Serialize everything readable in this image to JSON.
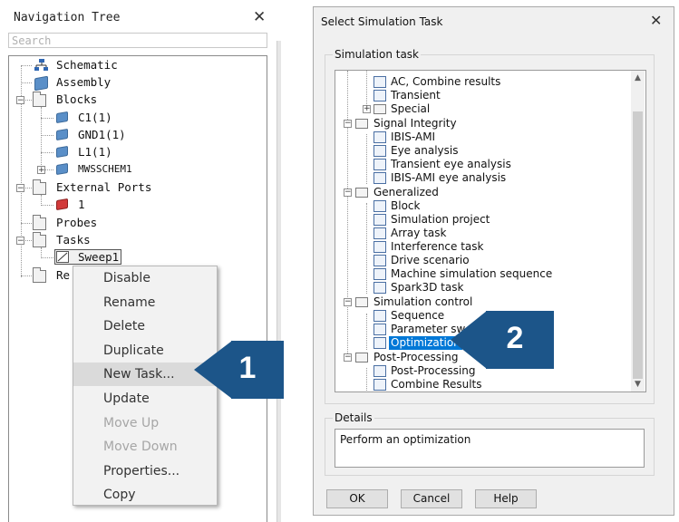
{
  "nav": {
    "title": "Navigation Tree",
    "close": "✕",
    "search_placeholder": "Search",
    "items": {
      "schematic": "Schematic",
      "assembly": "Assembly",
      "blocks": "Blocks",
      "c1": "C1(1)",
      "gnd1": "GND1(1)",
      "l1": "L1(1)",
      "mwsschem1": "MWSSCHEM1",
      "external_ports": "External Ports",
      "port1": "1",
      "probes": "Probes",
      "tasks": "Tasks",
      "sweep1": "Sweep1",
      "results_partial": "Re"
    }
  },
  "context_menu": {
    "items": [
      {
        "label": "Disable",
        "enabled": true
      },
      {
        "label": "Rename",
        "enabled": true
      },
      {
        "label": "Delete",
        "enabled": true
      },
      {
        "label": "Duplicate",
        "enabled": true
      },
      {
        "label": "New Task...",
        "enabled": true,
        "highlighted": true
      },
      {
        "label": "Update",
        "enabled": true
      },
      {
        "label": "Move Up",
        "enabled": false
      },
      {
        "label": "Move Down",
        "enabled": false
      },
      {
        "label": "Properties...",
        "enabled": true
      },
      {
        "label": "Copy",
        "enabled": true
      }
    ]
  },
  "callouts": {
    "one": "1",
    "two": "2",
    "color": "#1c5589"
  },
  "dialog": {
    "title": "Select Simulation Task",
    "close": "✕",
    "task_group_label": "Simulation task",
    "tasks": {
      "ac_combine": "AC, Combine results",
      "transient": "Transient",
      "special": "Special",
      "signal_integrity": "Signal Integrity",
      "ibis_ami": "IBIS-AMI",
      "eye_analysis": "Eye analysis",
      "transient_eye": "Transient eye analysis",
      "ibis_ami_eye": "IBIS-AMI eye analysis",
      "generalized": "Generalized",
      "block": "Block",
      "sim_project": "Simulation project",
      "array_task": "Array task",
      "interference": "Interference task",
      "drive_scenario": "Drive scenario",
      "machine_seq": "Machine simulation sequence",
      "spark3d": "Spark3D task",
      "sim_control": "Simulation control",
      "sequence": "Sequence",
      "param_sweep": "Parameter sweep",
      "optimization": "Optimization",
      "post_processing": "Post-Processing",
      "post_processing_item": "Post-Processing",
      "combine_results": "Combine Results"
    },
    "details_label": "Details",
    "details_text": "Perform an optimization",
    "buttons": {
      "ok": "OK",
      "cancel": "Cancel",
      "help": "Help"
    },
    "selection_color": "#0078d7"
  }
}
